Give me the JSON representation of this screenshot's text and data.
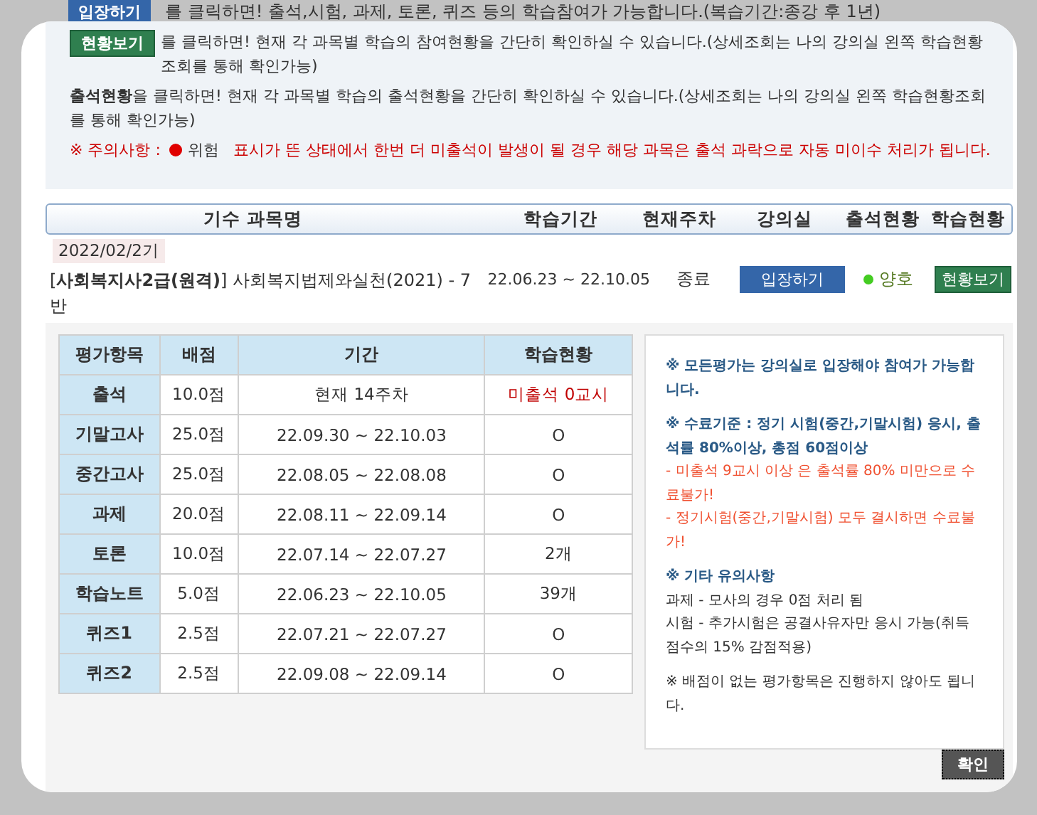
{
  "background_notice": {
    "button": "입장하기",
    "text": "를 클릭하면! 출석,시험, 과제, 토론, 퀴즈 등의 학습참여가 가능합니다.(복습기간:종강 후 1년)"
  },
  "notices": [
    {
      "kind": "button",
      "lead": "현황보기",
      "text": "를 클릭하면! 현재 각 과목별 학습의 참여현황을 간단히 확인하실 수 있습니다.(상세조회는 나의 강의실 왼쪽 학습현황조회를 통해 확인가능)"
    },
    {
      "kind": "bold",
      "lead": "출석현황",
      "text": "을 클릭하면! 현재 각 과목별 학습의 출석현황을 간단히 확인하실 수 있습니다.(상세조회는 나의 강의실 왼쪽 학습현황조회를 통해 확인가능)"
    },
    {
      "kind": "warning",
      "lead": "※ 주의사항 :",
      "badge": "위험",
      "text": "표시가 뜬 상태에서 한번 더 미출석이 발생이 될 경우 해당 과목은 출석 과락으로 자동 미이수 처리가 됩니다."
    }
  ],
  "course_table": {
    "columns": [
      "기수 과목명",
      "학습기간",
      "현재주차",
      "강의실",
      "출석현황",
      "학습현황"
    ],
    "row": {
      "term": "2022/02/2기",
      "title": "[**사회복지사2급(원격)**] 사회복지법제와실천(2021) - 7반",
      "period": "22.06.23 ~ 22.10.05",
      "week": "종료",
      "enter_button": "입장하기",
      "attendance": "양호",
      "status_button": "현황보기"
    }
  },
  "evaluation_table": {
    "columns": [
      "평가항목",
      "배점",
      "기간",
      "학습현황"
    ],
    "rows": [
      {
        "item": "출석",
        "score": "10.0점",
        "period": "현재 14주차",
        "status": "미출석 0교시",
        "alert": true
      },
      {
        "item": "기말고사",
        "score": "25.0점",
        "period": "22.09.30 ~ 22.10.03",
        "status": "O",
        "alert": false
      },
      {
        "item": "중간고사",
        "score": "25.0점",
        "period": "22.08.05 ~ 22.08.08",
        "status": "O",
        "alert": false
      },
      {
        "item": "과제",
        "score": "20.0점",
        "period": "22.08.11 ~ 22.09.14",
        "status": "O",
        "alert": false
      },
      {
        "item": "토론",
        "score": "10.0점",
        "period": "22.07.14 ~ 22.07.27",
        "status": "2개",
        "alert": false
      },
      {
        "item": "학습노트",
        "score": "5.0점",
        "period": "22.06.23 ~ 22.10.05",
        "status": "39개",
        "alert": false
      },
      {
        "item": "퀴즈1",
        "score": "2.5점",
        "period": "22.07.21 ~ 22.07.27",
        "status": "O",
        "alert": false
      },
      {
        "item": "퀴즈2",
        "score": "2.5점",
        "period": "22.09.08 ~ 22.09.14",
        "status": "O",
        "alert": false
      }
    ]
  },
  "notes": [
    {
      "lines": [
        {
          "kind": "heading",
          "text": "※ 모든평가는 강의실로 입장해야 참여가 가능합니다."
        }
      ]
    },
    {
      "lines": [
        {
          "kind": "heading",
          "text": "※ 수료기준 : 정기 시험(중간,기말시험) 응시, 출석률 80%이상, 총점 60점이상"
        },
        {
          "kind": "warning",
          "text": "- 미출석 9교시 이상 은 출석률 80% 미만으로 수료불가!"
        },
        {
          "kind": "warning",
          "text": "- 정기시험(중간,기말시험) 모두 결시하면 수료불가!"
        }
      ]
    },
    {
      "lines": [
        {
          "kind": "heading",
          "text": "※ 기타 유의사항"
        },
        {
          "kind": "plain",
          "text": "과제 - 모사의 경우 0점 처리 됨"
        },
        {
          "kind": "plain",
          "text": "시험 - 추가시험은 공결사유자만 응시 가능(취득 점수의 15% 감점적용)"
        }
      ]
    },
    {
      "lines": [
        {
          "kind": "plain",
          "text": "※ 배점이 없는 평가항목은 진행하지 않아도 됩니다."
        }
      ]
    }
  ],
  "confirm_button": "확인"
}
